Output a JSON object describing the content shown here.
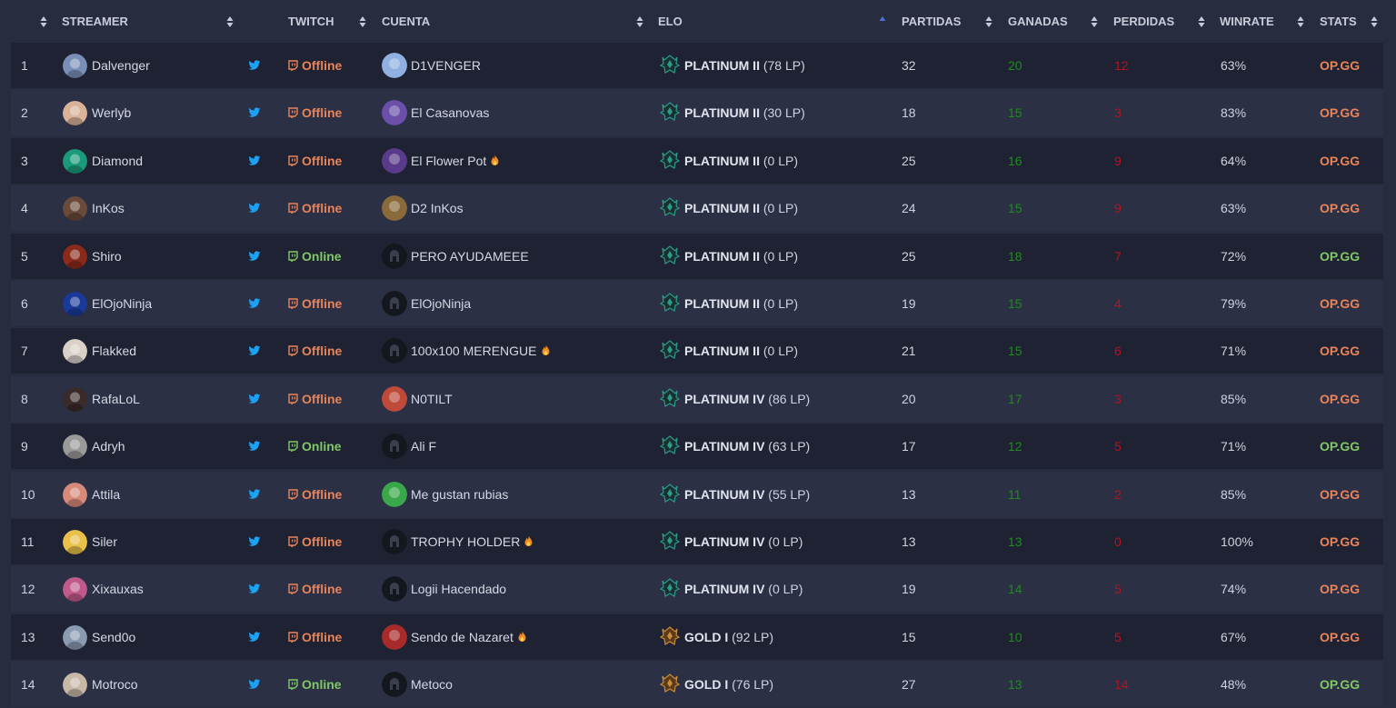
{
  "colors": {
    "offline": "#e8845a",
    "online": "#82c766",
    "twitter": "#1da1f2",
    "win": "#1e8c1e",
    "loss": "#b3141e",
    "sort_active": "#4c72d8",
    "platinum": "#2a9a8a",
    "gold": "#c98a3a"
  },
  "header": {
    "streamer": "STREAMER",
    "twitch": "TWITCH",
    "cuenta": "CUENTA",
    "elo": "ELO",
    "partidas": "PARTIDAS",
    "ganadas": "GANADAS",
    "perdidas": "PERDIDAS",
    "winrate": "WINRATE",
    "stats": "STATS"
  },
  "rows": [
    {
      "rank": "1",
      "streamer": "Dalvenger",
      "twitch": "Offline",
      "cuenta": "D1VENGER",
      "fire": false,
      "tier": "PLATINUM II",
      "lp": "(78 LP)",
      "elo_icon": "platinum-emblem-icon",
      "partidas": "32",
      "ganadas": "20",
      "perdidas": "12",
      "winrate": "63%",
      "stats": "OP.GG",
      "avatar": "#7a8fb8",
      "acct": "#8fb0e0"
    },
    {
      "rank": "2",
      "streamer": "Werlyb",
      "twitch": "Offline",
      "cuenta": "El Casanovas",
      "fire": false,
      "tier": "PLATINUM II",
      "lp": "(30 LP)",
      "elo_icon": "platinum-emblem-icon",
      "partidas": "18",
      "ganadas": "15",
      "perdidas": "3",
      "winrate": "83%",
      "stats": "OP.GG",
      "avatar": "#d8b39a",
      "acct": "#6b4fa8"
    },
    {
      "rank": "3",
      "streamer": "Diamond",
      "twitch": "Offline",
      "cuenta": "El Flower Pot",
      "fire": true,
      "tier": "PLATINUM II",
      "lp": "(0 LP)",
      "elo_icon": "platinum-emblem-icon",
      "partidas": "25",
      "ganadas": "16",
      "perdidas": "9",
      "winrate": "64%",
      "stats": "OP.GG",
      "avatar": "#1a9a7a",
      "acct": "#5a3a8a"
    },
    {
      "rank": "4",
      "streamer": "InKos",
      "twitch": "Offline",
      "cuenta": "D2 InKos",
      "fire": false,
      "tier": "PLATINUM II",
      "lp": "(0 LP)",
      "elo_icon": "platinum-emblem-icon",
      "partidas": "24",
      "ganadas": "15",
      "perdidas": "9",
      "winrate": "63%",
      "stats": "OP.GG",
      "avatar": "#6a4a3a",
      "acct": "#8a6a3a"
    },
    {
      "rank": "5",
      "streamer": "Shiro",
      "twitch": "Online",
      "cuenta": "PERO AYUDAMEEE",
      "fire": false,
      "tier": "PLATINUM II",
      "lp": "(0 LP)",
      "elo_icon": "platinum-emblem-icon",
      "partidas": "25",
      "ganadas": "18",
      "perdidas": "7",
      "winrate": "72%",
      "stats": "OP.GG",
      "avatar": "#8a2a1a",
      "acct": "#15171f"
    },
    {
      "rank": "6",
      "streamer": "ElOjoNinja",
      "twitch": "Offline",
      "cuenta": "ElOjoNinja",
      "fire": false,
      "tier": "PLATINUM II",
      "lp": "(0 LP)",
      "elo_icon": "platinum-emblem-icon",
      "partidas": "19",
      "ganadas": "15",
      "perdidas": "4",
      "winrate": "79%",
      "stats": "OP.GG",
      "avatar": "#1a3a9a",
      "acct": "#15171f"
    },
    {
      "rank": "7",
      "streamer": "Flakked",
      "twitch": "Offline",
      "cuenta": "100x100 MERENGUE",
      "fire": true,
      "tier": "PLATINUM II",
      "lp": "(0 LP)",
      "elo_icon": "platinum-emblem-icon",
      "partidas": "21",
      "ganadas": "15",
      "perdidas": "6",
      "winrate": "71%",
      "stats": "OP.GG",
      "avatar": "#d9d0c8",
      "acct": "#15171f"
    },
    {
      "rank": "8",
      "streamer": "RafaLoL",
      "twitch": "Offline",
      "cuenta": "N0TILT",
      "fire": false,
      "tier": "PLATINUM IV",
      "lp": "(86 LP)",
      "elo_icon": "platinum-emblem-icon",
      "partidas": "20",
      "ganadas": "17",
      "perdidas": "3",
      "winrate": "85%",
      "stats": "OP.GG",
      "avatar": "#3a2a2a",
      "acct": "#c04a3a"
    },
    {
      "rank": "9",
      "streamer": "Adryh",
      "twitch": "Online",
      "cuenta": "Ali F",
      "fire": false,
      "tier": "PLATINUM IV",
      "lp": "(63 LP)",
      "elo_icon": "platinum-emblem-icon",
      "partidas": "17",
      "ganadas": "12",
      "perdidas": "5",
      "winrate": "71%",
      "stats": "OP.GG",
      "avatar": "#9a9a9a",
      "acct": "#15171f"
    },
    {
      "rank": "10",
      "streamer": "Attila",
      "twitch": "Offline",
      "cuenta": "Me gustan rubias",
      "fire": false,
      "tier": "PLATINUM IV",
      "lp": "(55 LP)",
      "elo_icon": "platinum-emblem-icon",
      "partidas": "13",
      "ganadas": "11",
      "perdidas": "2",
      "winrate": "85%",
      "stats": "OP.GG",
      "avatar": "#d88a7a",
      "acct": "#3aa84a"
    },
    {
      "rank": "11",
      "streamer": "Siler",
      "twitch": "Offline",
      "cuenta": "TROPHY HOLDER",
      "fire": true,
      "tier": "PLATINUM IV",
      "lp": "(0 LP)",
      "elo_icon": "platinum-emblem-icon",
      "partidas": "13",
      "ganadas": "13",
      "perdidas": "0",
      "winrate": "100%",
      "stats": "OP.GG",
      "avatar": "#e8c04a",
      "acct": "#15171f"
    },
    {
      "rank": "12",
      "streamer": "Xixauxas",
      "twitch": "Offline",
      "cuenta": "Logii Hacendado",
      "fire": false,
      "tier": "PLATINUM IV",
      "lp": "(0 LP)",
      "elo_icon": "platinum-emblem-icon",
      "partidas": "19",
      "ganadas": "14",
      "perdidas": "5",
      "winrate": "74%",
      "stats": "OP.GG",
      "avatar": "#c05a8a",
      "acct": "#15171f"
    },
    {
      "rank": "13",
      "streamer": "Send0o",
      "twitch": "Offline",
      "cuenta": "Sendo de Nazaret",
      "fire": true,
      "tier": "GOLD I",
      "lp": "(92 LP)",
      "elo_icon": "gold-emblem-icon",
      "partidas": "15",
      "ganadas": "10",
      "perdidas": "5",
      "winrate": "67%",
      "stats": "OP.GG",
      "avatar": "#8a9ab0",
      "acct": "#a82a2a"
    },
    {
      "rank": "14",
      "streamer": "Motroco",
      "twitch": "Online",
      "cuenta": "Metoco",
      "fire": false,
      "tier": "GOLD I",
      "lp": "(76 LP)",
      "elo_icon": "gold-emblem-icon",
      "partidas": "27",
      "ganadas": "13",
      "perdidas": "14",
      "winrate": "48%",
      "stats": "OP.GG",
      "avatar": "#c8b8a8",
      "acct": "#15171f"
    }
  ]
}
